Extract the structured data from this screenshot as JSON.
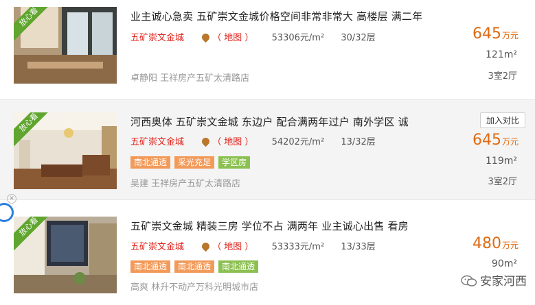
{
  "listings": [
    {
      "badge": "放心看",
      "title": "业主诚心急卖 五矿崇文金城价格空间非常非常大 高楼层 满二年",
      "community": "五矿崇文金城",
      "map_label": "（ 地图 ）",
      "unit_price": "53306元/m²",
      "floor": "30/32层",
      "tags": [],
      "agent": "卓静阳 王祥房产五矿太清路店",
      "price": "645",
      "price_unit": "万元",
      "area": "121m²",
      "layout": "3室2厅",
      "compare_button": ""
    },
    {
      "badge": "放心看",
      "title": "河西奥体 五矿崇文金城 东边户 配合满两年过户 南外学区 诚",
      "community": "五矿崇文金城",
      "map_label": "（ 地图 ）",
      "unit_price": "54202元/m²",
      "floor": "13/32层",
      "tags": [
        {
          "label": "南北通透",
          "color": "#f29a5a"
        },
        {
          "label": "采光充足",
          "color": "#f29a5a"
        },
        {
          "label": "学区房",
          "color": "#8cc152"
        }
      ],
      "agent": "吴建 王祥房产五矿太清路店",
      "price": "645",
      "price_unit": "万元",
      "area": "119m²",
      "layout": "3室2厅",
      "compare_button": "加入对比"
    },
    {
      "badge": "放心看",
      "title": "五矿崇文金城 精装三房 学位不占 满两年 业主诚心出售 看房",
      "community": "五矿崇文金城",
      "map_label": "（ 地图 ）",
      "unit_price": "53333元/m²",
      "floor": "13/33层",
      "tags": [
        {
          "label": "南北通透",
          "color": "#f29a5a"
        },
        {
          "label": "南北通透",
          "color": "#f29a5a"
        },
        {
          "label": "南北通透",
          "color": "#8cc152"
        }
      ],
      "agent": "高爽 林升不动产万科光明城市店",
      "price": "480",
      "price_unit": "万元",
      "area": "90m²",
      "layout": "",
      "compare_button": ""
    }
  ],
  "watermark": "安家河西",
  "colors": {
    "price": "#e06a13",
    "community": "#e0231b",
    "badge": "#5fa52e"
  }
}
